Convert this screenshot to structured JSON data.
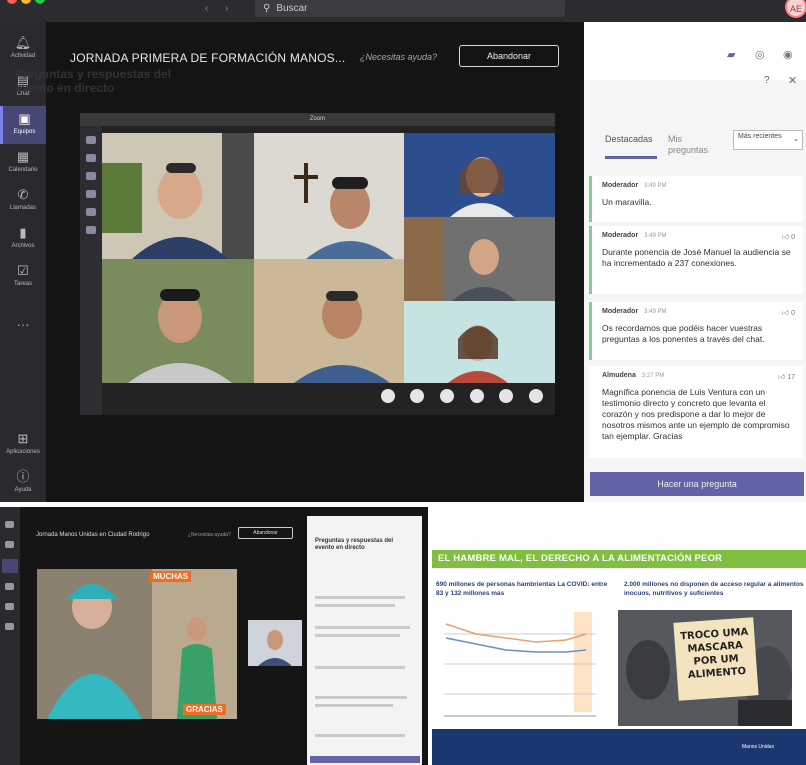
{
  "topbar": {
    "search_placeholder": "Buscar",
    "avatar_initials": "AE"
  },
  "rail": {
    "items": [
      {
        "label": "Actividad",
        "icon": "bell-icon"
      },
      {
        "label": "Chat",
        "icon": "chat-icon"
      },
      {
        "label": "Equipos",
        "icon": "teams-icon"
      },
      {
        "label": "Calendario",
        "icon": "calendar-icon"
      },
      {
        "label": "Llamadas",
        "icon": "phone-icon"
      },
      {
        "label": "Archivos",
        "icon": "file-icon"
      },
      {
        "label": "Tareas",
        "icon": "tasks-icon"
      },
      {
        "label": "Aplicaciones",
        "icon": "apps-icon"
      },
      {
        "label": "Ayuda",
        "icon": "help-icon"
      }
    ]
  },
  "meeting": {
    "title": "JORNADA PRIMERA DE FORMACIÓN MANOS...",
    "help": "¿Necesitas ayuda?",
    "leave_label": "Abandonar",
    "shared_window_title": "Zoom"
  },
  "qa": {
    "title": "Preguntas y respuestas del evento en directo",
    "tab_featured": "Destacadas",
    "tab_mine": "Mis preguntas",
    "sort_label": "Más recientes",
    "messages": [
      {
        "author": "Moderador",
        "time": "3:49 PM",
        "likes": "",
        "text": "Un maravilla."
      },
      {
        "author": "Moderador",
        "time": "3:49 PM",
        "likes": "0",
        "text": "Durante ponencia de José Manuel la audiencia se ha incrementado a 237 conexiones."
      },
      {
        "author": "Moderador",
        "time": "3:49 PM",
        "likes": "0",
        "text": "Os recordamos que podéis hacer vuestras preguntas a los ponentes a través del chat."
      },
      {
        "author": "Almudena",
        "time": "3:27 PM",
        "likes": "17",
        "text": "Magnífica ponencia de Luis Ventura con un testimonio directo y concreto que levanta el corazón y nos predispone a dar lo mejor de nosotros mismos ante un ejemplo de compromiso tan ejemplar. Gracias"
      }
    ],
    "ask_label": "Hacer una pregunta"
  },
  "bottom_left": {
    "title": "Jornada Manos Unidas en Ciudad Rodrigo",
    "help": "¿Necesitas ayuda?",
    "leave_label": "Abandonar",
    "qa_title": "Preguntas y respuestas del evento en directo",
    "label_top": "MUCHAS",
    "label_bottom": "GRACIAS"
  },
  "slide": {
    "header": "EL HAMBRE MAL, EL DERECHO A LA ALIMENTACIÓN PEOR",
    "col1": "690 millones de personas hambrientas La COVID: entre 83 y 132 millones más",
    "col2": "2.000 millones no disponen de acceso regular a alimentos inocuos, nutritivos y suficientes",
    "sign_text": "TROCO UMA MASCARA POR UM ALIMENTO",
    "logo": "Manos Unidas"
  },
  "colors": {
    "accent": "#6264a7",
    "slide_green": "#7fbf3f",
    "slide_navy": "#1b3770",
    "label_orange": "#f26b21"
  }
}
